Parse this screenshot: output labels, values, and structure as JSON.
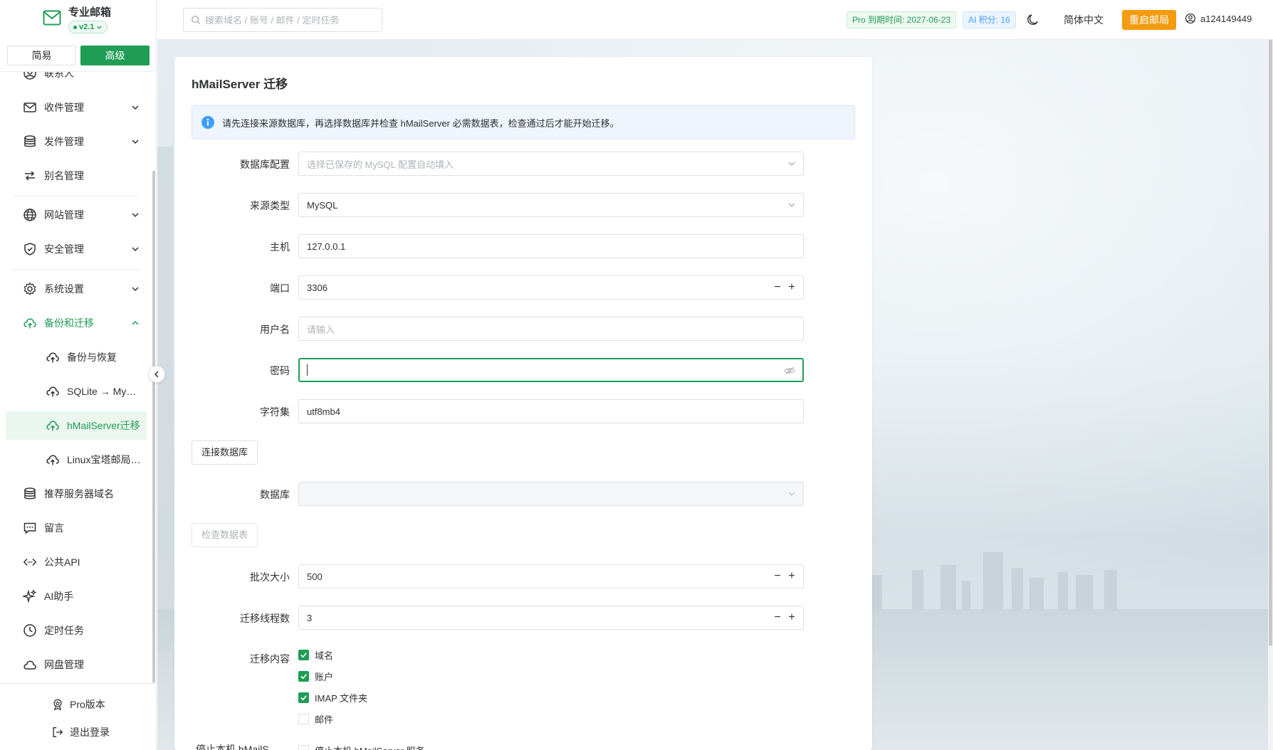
{
  "brand": {
    "title": "专业邮箱",
    "version": "v2.1"
  },
  "modes": {
    "simple": "简易",
    "advanced": "高级"
  },
  "sidebar": {
    "items": [
      {
        "label": "联系人",
        "icon": "contacts-icon"
      },
      {
        "label": "收件管理",
        "icon": "mail-icon"
      },
      {
        "label": "发件管理",
        "icon": "database-icon"
      },
      {
        "label": "别名管理",
        "icon": "swap-icon"
      },
      {
        "label": "网站管理",
        "icon": "globe-icon"
      },
      {
        "label": "安全管理",
        "icon": "shield-icon"
      },
      {
        "label": "系统设置",
        "icon": "gear-icon"
      },
      {
        "label": "备份和迁移",
        "icon": "cloud-upload-icon"
      },
      {
        "label": "备份与恢复",
        "icon": "cloud-upload-icon"
      },
      {
        "label": "SQLite → MySQL",
        "icon": "cloud-upload-icon"
      },
      {
        "label": "hMailServer迁移",
        "icon": "cloud-upload-icon"
      },
      {
        "label": "Linux宝塔邮局迁移",
        "icon": "cloud-upload-icon"
      },
      {
        "label": "推荐服务器域名",
        "icon": "database-icon"
      },
      {
        "label": "留言",
        "icon": "message-icon"
      },
      {
        "label": "公共API",
        "icon": "api-icon"
      },
      {
        "label": "AI助手",
        "icon": "sparkle-icon"
      },
      {
        "label": "定时任务",
        "icon": "clock-icon"
      },
      {
        "label": "网盘管理",
        "icon": "cloud-icon"
      }
    ],
    "footer": {
      "pro": "Pro版本",
      "logout": "退出登录"
    }
  },
  "header": {
    "search_placeholder": "搜索域名 / 账号 / 邮件 / 定时任务",
    "pro_tag": "Pro 到期时间: 2027-06-23",
    "ai_tag": "AI 积分: 16",
    "language": "简体中文",
    "restart": "重启邮局",
    "username": "a124149449"
  },
  "form": {
    "title": "hMailServer 迁移",
    "notice": "请先连接来源数据库，再选择数据库并检查 hMailServer 必需数据表，检查通过后才能开始迁移。",
    "db_config": {
      "label": "数据库配置",
      "placeholder": "选择已保存的 MySQL 配置自动填入"
    },
    "source_type": {
      "label": "来源类型",
      "value": "MySQL"
    },
    "host": {
      "label": "主机",
      "value": "127.0.0.1"
    },
    "port": {
      "label": "端口",
      "value": "3306"
    },
    "username": {
      "label": "用户名",
      "placeholder": "请输入"
    },
    "password": {
      "label": "密码",
      "value": ""
    },
    "charset": {
      "label": "字符集",
      "value": "utf8mb4"
    },
    "connect_button": "连接数据库",
    "database": {
      "label": "数据库",
      "value": ""
    },
    "check_button": "检查数据表",
    "batch_size": {
      "label": "批次大小",
      "value": "500"
    },
    "threads": {
      "label": "迁移线程数",
      "value": "3"
    },
    "content": {
      "label": "迁移内容",
      "options": [
        {
          "label": "域名",
          "checked": true
        },
        {
          "label": "账户",
          "checked": true
        },
        {
          "label": "IMAP 文件夹",
          "checked": true
        },
        {
          "label": "邮件",
          "checked": false
        }
      ]
    },
    "stop_label": "停止本机 hMailS",
    "stop_option": "停止本机 hMailServer 服务"
  },
  "colors": {
    "accent": "#1f9d55",
    "warning": "#f39c12",
    "info": "#409eff"
  }
}
